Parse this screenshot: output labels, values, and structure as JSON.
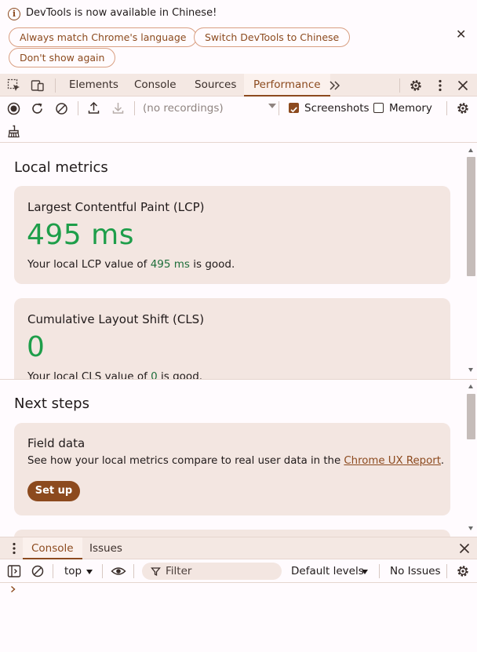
{
  "infobar": {
    "message": "DevTools is now available in Chinese!",
    "buttons": [
      "Always match Chrome's language",
      "Switch DevTools to Chinese",
      "Don't show again"
    ]
  },
  "tabs": {
    "items": [
      "Elements",
      "Console",
      "Sources",
      "Performance"
    ],
    "active": "Performance"
  },
  "perf_toolbar": {
    "recordings_placeholder": "(no recordings)",
    "screenshots_label": "Screenshots",
    "screenshots_checked": true,
    "memory_label": "Memory",
    "memory_checked": false
  },
  "local_metrics": {
    "title": "Local metrics",
    "lcp": {
      "title": "Largest Contentful Paint (LCP)",
      "value": "495 ms",
      "desc_pre": "Your local LCP value of ",
      "desc_value": "495 ms",
      "desc_post": " is good."
    },
    "cls": {
      "title": "Cumulative Layout Shift (CLS)",
      "value": "0",
      "desc_pre": "Your local CLS value of ",
      "desc_value": "0",
      "desc_post": " is good."
    }
  },
  "next_steps": {
    "title": "Next steps",
    "field": {
      "title": "Field data",
      "desc_pre": "See how your local metrics compare to real user data in the ",
      "link": "Chrome UX Report",
      "desc_post": ".",
      "button": "Set up"
    }
  },
  "drawer": {
    "tabs": [
      "Console",
      "Issues"
    ],
    "active": "Console",
    "context": "top",
    "filter_placeholder": "Filter",
    "levels": "Default levels",
    "issues": "No Issues"
  },
  "colors": {
    "accent": "#8c4a1e",
    "good": "#1e9e4a",
    "card_bg": "#f3e6e1"
  }
}
